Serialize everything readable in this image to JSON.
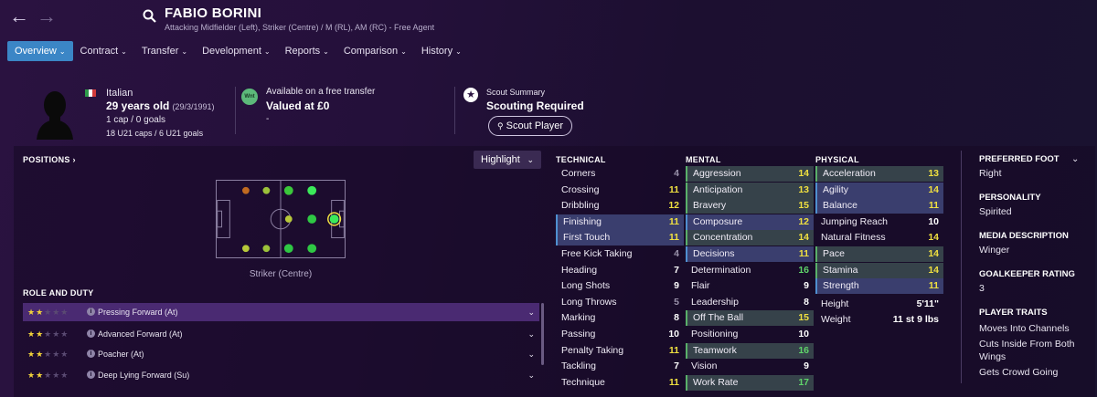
{
  "header": {
    "name": "FABIO BORINI",
    "subtitle": "Attacking Midfielder (Left), Striker (Centre) / M (RL), AM (RC) - Free Agent"
  },
  "tabs": [
    {
      "label": "Overview",
      "active": true
    },
    {
      "label": "Contract"
    },
    {
      "label": "Transfer"
    },
    {
      "label": "Development"
    },
    {
      "label": "Reports"
    },
    {
      "label": "Comparison"
    },
    {
      "label": "History"
    }
  ],
  "profile": {
    "nationality": "Italian",
    "age": "29 years old",
    "dob": "(29/3/1991)",
    "caps": "1 cap / 0 goals",
    "u21": "18 U21 caps / 6 U21 goals"
  },
  "transfer": {
    "badge": "Wnt",
    "status": "Available on a free transfer",
    "value": "Valued at £0",
    "dash": "-"
  },
  "scout": {
    "label": "Scout Summary",
    "status": "Scouting Required",
    "button": "Scout Player"
  },
  "positions": {
    "title": "POSITIONS",
    "highlight": "Highlight",
    "position_label": "Striker (Centre)"
  },
  "roles": {
    "title": "ROLE AND DUTY",
    "items": [
      {
        "name": "Pressing Forward (At)",
        "stars": 2
      },
      {
        "name": "Advanced Forward (At)",
        "stars": 2
      },
      {
        "name": "Poacher (At)",
        "stars": 2
      },
      {
        "name": "Deep Lying Forward (Su)",
        "stars": 2
      }
    ]
  },
  "technical": {
    "title": "TECHNICAL",
    "items": [
      {
        "name": "Corners",
        "value": "4",
        "hl": ""
      },
      {
        "name": "Crossing",
        "value": "11",
        "hl": ""
      },
      {
        "name": "Dribbling",
        "value": "12",
        "hl": ""
      },
      {
        "name": "Finishing",
        "value": "11",
        "hl": "blue"
      },
      {
        "name": "First Touch",
        "value": "11",
        "hl": "blue"
      },
      {
        "name": "Free Kick Taking",
        "value": "4",
        "hl": ""
      },
      {
        "name": "Heading",
        "value": "7",
        "hl": ""
      },
      {
        "name": "Long Shots",
        "value": "9",
        "hl": ""
      },
      {
        "name": "Long Throws",
        "value": "5",
        "hl": ""
      },
      {
        "name": "Marking",
        "value": "8",
        "hl": ""
      },
      {
        "name": "Passing",
        "value": "10",
        "hl": ""
      },
      {
        "name": "Penalty Taking",
        "value": "11",
        "hl": ""
      },
      {
        "name": "Tackling",
        "value": "7",
        "hl": ""
      },
      {
        "name": "Technique",
        "value": "11",
        "hl": ""
      }
    ]
  },
  "mental": {
    "title": "MENTAL",
    "items": [
      {
        "name": "Aggression",
        "value": "14",
        "hl": "green"
      },
      {
        "name": "Anticipation",
        "value": "13",
        "hl": "green"
      },
      {
        "name": "Bravery",
        "value": "15",
        "hl": "green"
      },
      {
        "name": "Composure",
        "value": "12",
        "hl": "blue"
      },
      {
        "name": "Concentration",
        "value": "14",
        "hl": "green"
      },
      {
        "name": "Decisions",
        "value": "11",
        "hl": "blue"
      },
      {
        "name": "Determination",
        "value": "16",
        "hl": ""
      },
      {
        "name": "Flair",
        "value": "9",
        "hl": ""
      },
      {
        "name": "Leadership",
        "value": "8",
        "hl": ""
      },
      {
        "name": "Off The Ball",
        "value": "15",
        "hl": "green"
      },
      {
        "name": "Positioning",
        "value": "10",
        "hl": ""
      },
      {
        "name": "Teamwork",
        "value": "16",
        "hl": "green"
      },
      {
        "name": "Vision",
        "value": "9",
        "hl": ""
      },
      {
        "name": "Work Rate",
        "value": "17",
        "hl": "green"
      }
    ]
  },
  "physical": {
    "title": "PHYSICAL",
    "items": [
      {
        "name": "Acceleration",
        "value": "13",
        "hl": "green"
      },
      {
        "name": "Agility",
        "value": "14",
        "hl": "blue"
      },
      {
        "name": "Balance",
        "value": "11",
        "hl": "blue"
      },
      {
        "name": "Jumping Reach",
        "value": "10",
        "hl": ""
      },
      {
        "name": "Natural Fitness",
        "value": "14",
        "hl": ""
      },
      {
        "name": "Pace",
        "value": "14",
        "hl": "green"
      },
      {
        "name": "Stamina",
        "value": "14",
        "hl": "green"
      },
      {
        "name": "Strength",
        "value": "11",
        "hl": "blue"
      }
    ],
    "height_label": "Height",
    "height": "5'11\"",
    "weight_label": "Weight",
    "weight": "11 st 9 lbs"
  },
  "info": {
    "foot_title": "PREFERRED FOOT",
    "foot": "Right",
    "personality_title": "PERSONALITY",
    "personality": "Spirited",
    "media_title": "MEDIA DESCRIPTION",
    "media": "Winger",
    "gk_title": "GOALKEEPER RATING",
    "gk": "3",
    "traits_title": "PLAYER TRAITS",
    "traits": [
      "Moves Into Channels",
      "Cuts Inside From Both",
      "Wings",
      "Gets Crowd Going"
    ]
  }
}
